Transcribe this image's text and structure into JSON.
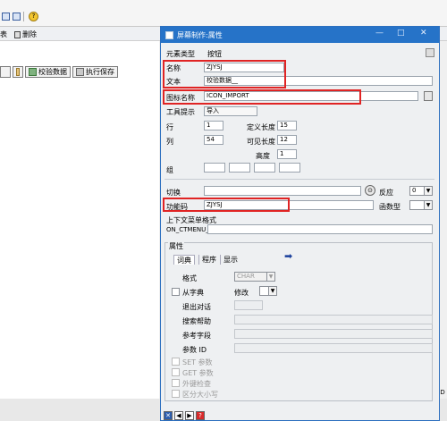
{
  "app": {
    "toolbar_delete_label": "删除",
    "toolbar_left_label": "表",
    "screen_buttons": [
      {
        "label": "校验数据"
      },
      {
        "label": "执行保存"
      }
    ],
    "bottom_right_fragment": "ED"
  },
  "dialog": {
    "title": "屏幕制作:属性",
    "element_type": {
      "label": "元素类型",
      "value": "按钮"
    },
    "name": {
      "label": "名称",
      "value": "ZJYSJ"
    },
    "text": {
      "label": "文本",
      "value": "校验数据__"
    },
    "icon_name": {
      "label": "图标名称",
      "value": "ICON_IMPORT"
    },
    "tooltip": {
      "label": "工具提示",
      "value": "导入"
    },
    "row": {
      "label": "行",
      "value": "1"
    },
    "col": {
      "label": "列",
      "value": "54"
    },
    "def_len": {
      "label": "定义长度",
      "value": "15"
    },
    "vis_len": {
      "label": "可见长度",
      "value": "12"
    },
    "height": {
      "label": "高度",
      "value": "1"
    },
    "group": {
      "label": "组"
    },
    "switch": {
      "label": "切换"
    },
    "reaction": {
      "label": "反应",
      "value": "0"
    },
    "fcode": {
      "label": "功能码",
      "value": "ZJYSJ"
    },
    "func_type": {
      "label": "函数型",
      "value": ""
    },
    "context_menu": {
      "label": "上下文菜单格式",
      "value": "ON_CTMENU_"
    },
    "attributes": {
      "label": "属性",
      "tabs": [
        "词典",
        "程序",
        "显示"
      ],
      "format": {
        "label": "格式",
        "value": "CHAR"
      },
      "from_dict": {
        "label": "从字典"
      },
      "modify": {
        "label": "修改"
      },
      "exit_dialog": {
        "label": "退出对话"
      },
      "search_help": {
        "label": "搜索帮助"
      },
      "ref_field": {
        "label": "参考字段"
      },
      "param_id": {
        "label": "参数 ID"
      },
      "set_param": {
        "label": "SET 参数"
      },
      "get_param": {
        "label": "GET 参数"
      },
      "foreign_key": {
        "label": "外键检查"
      },
      "upper_lower": {
        "label": "区分大小写"
      }
    }
  }
}
